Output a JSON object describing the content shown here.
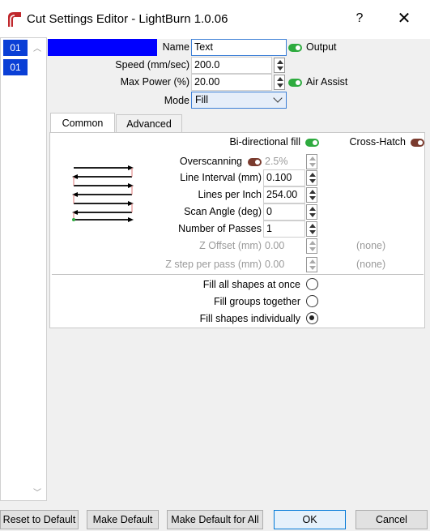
{
  "window": {
    "title": "Cut Settings Editor - LightBurn 1.0.06",
    "help": "?",
    "close": "✕"
  },
  "layers": [
    {
      "label": "01"
    },
    {
      "label": "01"
    }
  ],
  "layer_color": "#0000ff",
  "form": {
    "name_label": "Name",
    "name_value": "Text",
    "output_label": "Output",
    "output_on": true,
    "speed_label": "Speed (mm/sec)",
    "speed_value": "200.0",
    "power_label": "Max Power (%)",
    "power_value": "20.00",
    "air_label": "Air Assist",
    "air_on": true,
    "mode_label": "Mode",
    "mode_value": "Fill"
  },
  "tabs": [
    {
      "label": "Common",
      "active": true
    },
    {
      "label": "Advanced",
      "active": false
    }
  ],
  "common": {
    "bidir_label": "Bi-directional fill",
    "bidir_on": true,
    "crosshatch_label": "Cross-Hatch",
    "crosshatch_on": false,
    "overscan_label": "Overscanning",
    "overscan_on": false,
    "overscan_value": "2.5%",
    "interval_label": "Line Interval (mm)",
    "interval_value": "0.100",
    "lpi_label": "Lines per Inch",
    "lpi_value": "254.00",
    "angle_label": "Scan Angle (deg)",
    "angle_value": "0",
    "passes_label": "Number of Passes",
    "passes_value": "1",
    "zoffset_label": "Z Offset (mm)",
    "zoffset_value": "0.00",
    "zoffset_extra": "(none)",
    "zstep_label": "Z step per pass (mm)",
    "zstep_value": "0.00",
    "zstep_extra": "(none)",
    "fill_options": [
      {
        "label": "Fill all shapes at once",
        "checked": false
      },
      {
        "label": "Fill groups together",
        "checked": false
      },
      {
        "label": "Fill shapes individually",
        "checked": true
      }
    ]
  },
  "buttons": {
    "reset": "Reset to Default",
    "make_default": "Make Default",
    "make_default_all": "Make Default for All",
    "ok": "OK",
    "cancel": "Cancel"
  },
  "colors": {
    "layer_blue": "#0a3fd6",
    "toggle_on": "#2eab3f",
    "toggle_off": "#7a3b2e",
    "default_button": "#0078d7"
  }
}
